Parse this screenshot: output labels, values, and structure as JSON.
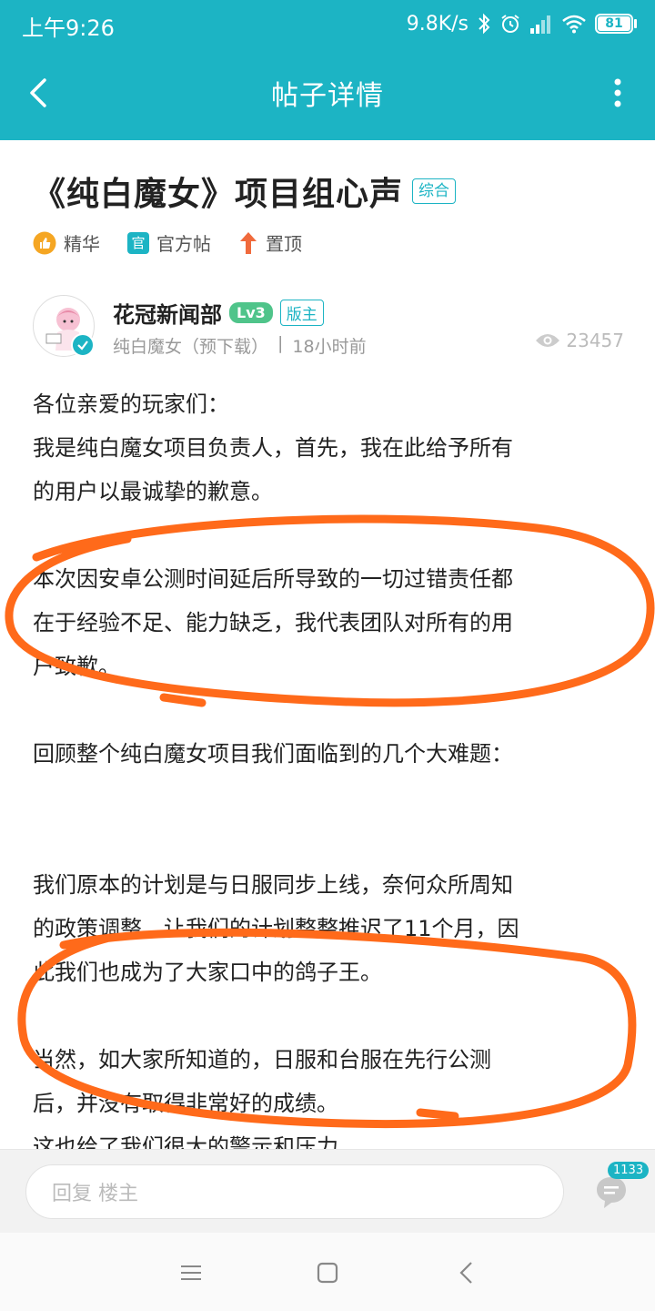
{
  "status": {
    "time": "上午9:26",
    "speed": "9.8K/s",
    "battery": "81",
    "icons": [
      "bluetooth-icon",
      "alarm-icon",
      "signal-icon",
      "wifi-icon",
      "battery-icon"
    ]
  },
  "header": {
    "title": "帖子详情"
  },
  "post": {
    "title": "《纯白魔女》项目组心声",
    "category": "综合",
    "tags": [
      {
        "icon": "thumbs-up-icon",
        "label": "精华"
      },
      {
        "icon": "official-icon",
        "icon_text": "官",
        "label": "官方帖"
      },
      {
        "icon": "pin-arrow-icon",
        "label": "置顶"
      }
    ]
  },
  "author": {
    "name": "花冠新闻部",
    "level": "Lv3",
    "role": "版主",
    "game": "纯白魔女（预下载）",
    "separator": "|",
    "time": "18小时前",
    "views": "23457"
  },
  "content": {
    "p1_l1": "各位亲爱的玩家们：",
    "p1_l2": "我是纯白魔女项目负责人，首先，我在此给予所有",
    "p1_l3": "的用户以最诚挚的歉意。",
    "p2_l1": "本次因安卓公测时间延后所导致的一切过错责任都",
    "p2_l2": "在于经验不足、能力缺乏，我代表团队对所有的用",
    "p2_l3": "户致歉。",
    "p3_l1": "回顾整个纯白魔女项目我们面临到的几个大难题：",
    "p4_l1": "我们原本的计划是与日服同步上线，奈何众所周知",
    "p4_l2": "的政策调整，让我们的计划整整推迟了11个月，因",
    "p4_l3": "此我们也成为了大家口中的鸽子王。",
    "p5_l1": "当然，如大家所知道的，日服和台服在先行公测",
    "p5_l2": "后，并没有取得非常好的成绩。",
    "p5_l3": "这也给了我们很大的警示和压力。"
  },
  "reply": {
    "placeholder": "回复  楼主",
    "comment_count": "1133"
  },
  "colors": {
    "accent": "#1cb4c4",
    "annotation": "#ff6a1a",
    "level": "#4fc48a"
  }
}
